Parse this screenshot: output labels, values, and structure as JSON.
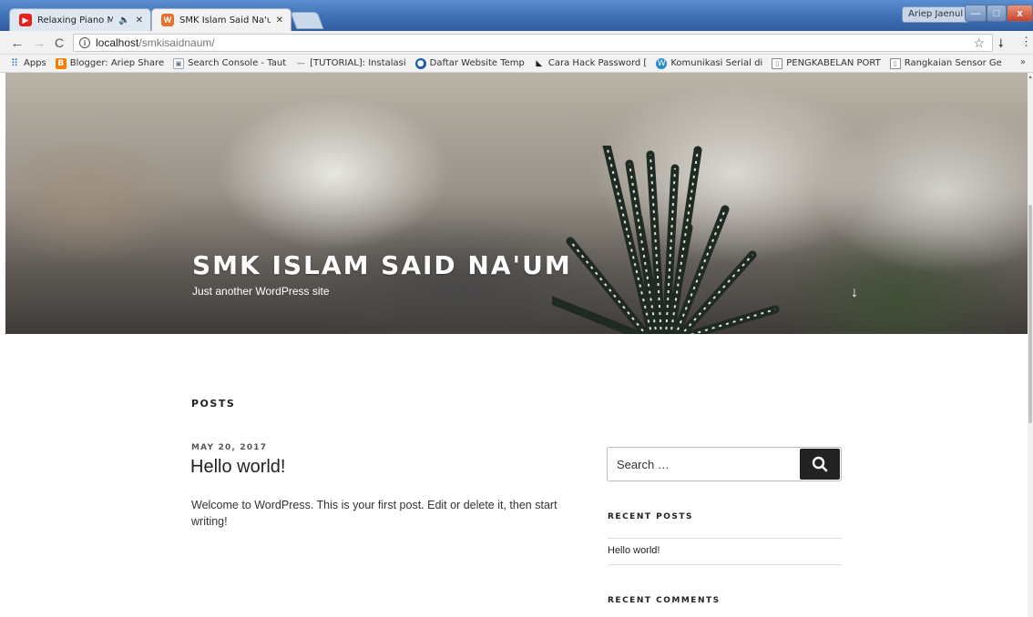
{
  "browser": {
    "tabs": [
      {
        "title": "Relaxing Piano Music:",
        "favicon": "youtube-icon",
        "audio": "speaker-icon"
      },
      {
        "title": "SMK Islam Said Na'um –",
        "favicon": "wordpress-icon"
      }
    ],
    "user_chip": "Ariep Jaenul",
    "window_buttons": {
      "minimize": "—",
      "maximize": "□",
      "close": "x"
    },
    "nav": {
      "back": "←",
      "forward": "→",
      "reload": "C"
    },
    "url": {
      "host": "localhost",
      "path": "/smkisaidnaum/"
    },
    "bookmarks": [
      {
        "label": "Apps",
        "icon": "apps-grid-icon"
      },
      {
        "label": "Blogger: Ariep Share",
        "icon": "blogger-icon"
      },
      {
        "label": "Search Console - Taut",
        "icon": "search-console-icon"
      },
      {
        "label": "[TUTORIAL]: Instalasi",
        "icon": "dash-icon"
      },
      {
        "label": "Daftar Website Temp",
        "icon": "globe-icon"
      },
      {
        "label": "Cara Hack Password [",
        "icon": "hack-icon"
      },
      {
        "label": "Komunikasi Serial di",
        "icon": "wordpress-icon"
      },
      {
        "label": "PENGKABELAN PORT",
        "icon": "page-icon"
      },
      {
        "label": "Rangkaian Sensor Ge",
        "icon": "page-icon"
      }
    ],
    "bookmarks_more": "»"
  },
  "site": {
    "title": "SMK ISLAM SAID NA'UM",
    "tagline": "Just another WordPress site",
    "scroll_arrow": "↓"
  },
  "main": {
    "posts_heading": "POSTS",
    "post": {
      "date": "MAY 20, 2017",
      "title": "Hello world!",
      "excerpt": "Welcome to WordPress. This is your first post. Edit or delete it, then start writing!"
    }
  },
  "sidebar": {
    "search_placeholder": "Search …",
    "recent_posts_heading": "RECENT POSTS",
    "recent_posts": [
      "Hello world!"
    ],
    "recent_comments_heading": "RECENT COMMENTS"
  },
  "colors": {
    "titlebar": "#3f6fb5",
    "text_dark": "#222222",
    "search_button": "#222222"
  }
}
